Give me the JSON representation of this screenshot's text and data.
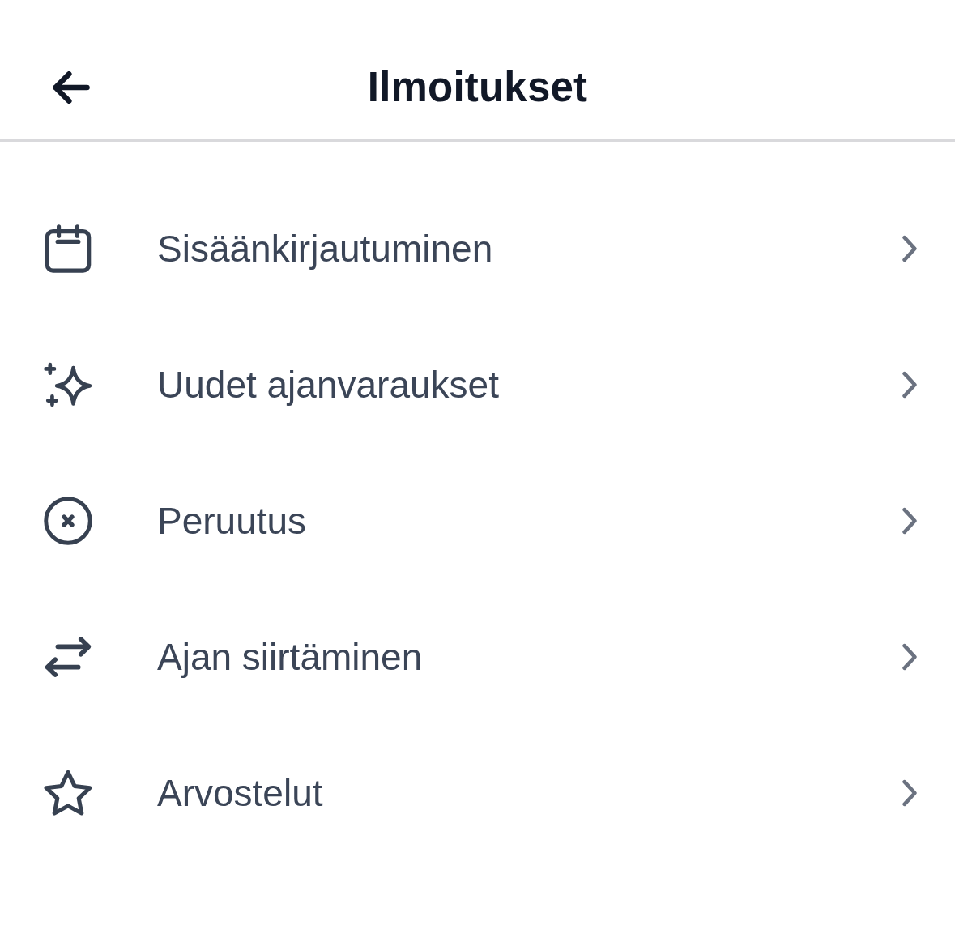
{
  "header": {
    "title": "Ilmoitukset"
  },
  "items": [
    {
      "label": "Sisäänkirjautuminen"
    },
    {
      "label": "Uudet ajanvaraukset"
    },
    {
      "label": "Peruutus"
    },
    {
      "label": "Ajan siirtäminen"
    },
    {
      "label": "Arvostelut"
    }
  ]
}
